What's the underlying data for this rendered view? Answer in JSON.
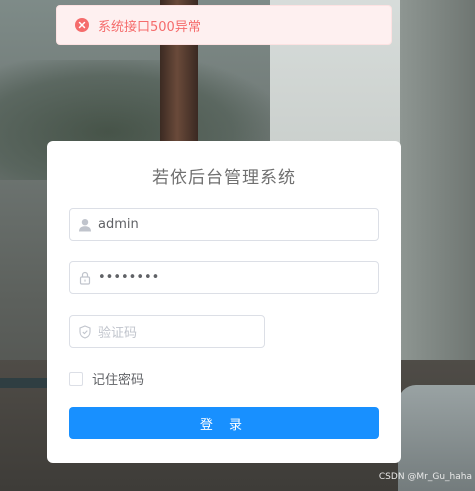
{
  "alert": {
    "message": "系统接口500异常",
    "icon": "error-circle-icon",
    "color": "#f56c6c"
  },
  "login": {
    "title": "若依后台管理系统",
    "username": {
      "value": "admin",
      "icon": "user-icon"
    },
    "password": {
      "value": "••••••••",
      "icon": "lock-icon"
    },
    "captcha": {
      "placeholder": "验证码",
      "icon": "shield-icon"
    },
    "remember_label": "记住密码",
    "submit_label": "登 录",
    "accent": "#1890ff"
  },
  "watermark": "CSDN @Mr_Gu_haha"
}
